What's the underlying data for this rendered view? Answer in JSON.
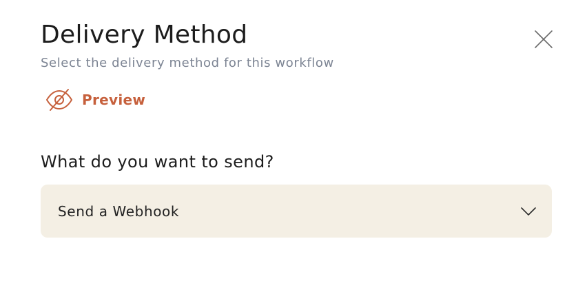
{
  "dialog": {
    "title": "Delivery Method",
    "subtitle": "Select the delivery method for this workflow",
    "close_icon": "close-icon",
    "preview": {
      "label": "Preview",
      "icon": "eye-off-icon",
      "color": "#c6603c"
    },
    "question": "What do you want to send?",
    "select": {
      "value": "Send a Webhook",
      "icon": "chevron-down-icon",
      "background": "#f4efe4"
    }
  }
}
